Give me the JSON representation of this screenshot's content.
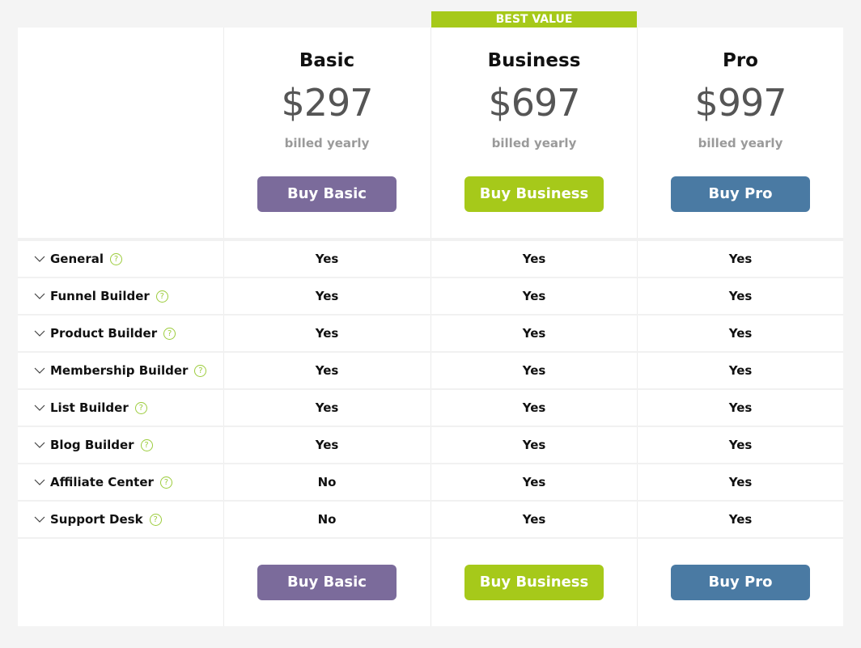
{
  "badge": {
    "text": "BEST VALUE",
    "color": "#a6c91a"
  },
  "plans": [
    {
      "name": "Basic",
      "price": "$297",
      "billing": "billed yearly",
      "button": "Buy Basic",
      "color": "#7b6b9b"
    },
    {
      "name": "Business",
      "price": "$697",
      "billing": "billed yearly",
      "button": "Buy Business",
      "color": "#a6c91a"
    },
    {
      "name": "Pro",
      "price": "$997",
      "billing": "billed yearly",
      "button": "Buy Pro",
      "color": "#4a7aa3"
    }
  ],
  "features": [
    {
      "label": "General",
      "values": [
        "Yes",
        "Yes",
        "Yes"
      ]
    },
    {
      "label": "Funnel Builder",
      "values": [
        "Yes",
        "Yes",
        "Yes"
      ]
    },
    {
      "label": "Product Builder",
      "values": [
        "Yes",
        "Yes",
        "Yes"
      ]
    },
    {
      "label": "Membership Builder",
      "values": [
        "Yes",
        "Yes",
        "Yes"
      ]
    },
    {
      "label": "List Builder",
      "values": [
        "Yes",
        "Yes",
        "Yes"
      ]
    },
    {
      "label": "Blog Builder",
      "values": [
        "Yes",
        "Yes",
        "Yes"
      ]
    },
    {
      "label": "Affiliate Center",
      "values": [
        "No",
        "Yes",
        "Yes"
      ]
    },
    {
      "label": "Support Desk",
      "values": [
        "No",
        "Yes",
        "Yes"
      ]
    }
  ],
  "icons": {
    "expand": "chevron-down-icon",
    "help": "question-circle-icon",
    "help_glyph": "?"
  }
}
